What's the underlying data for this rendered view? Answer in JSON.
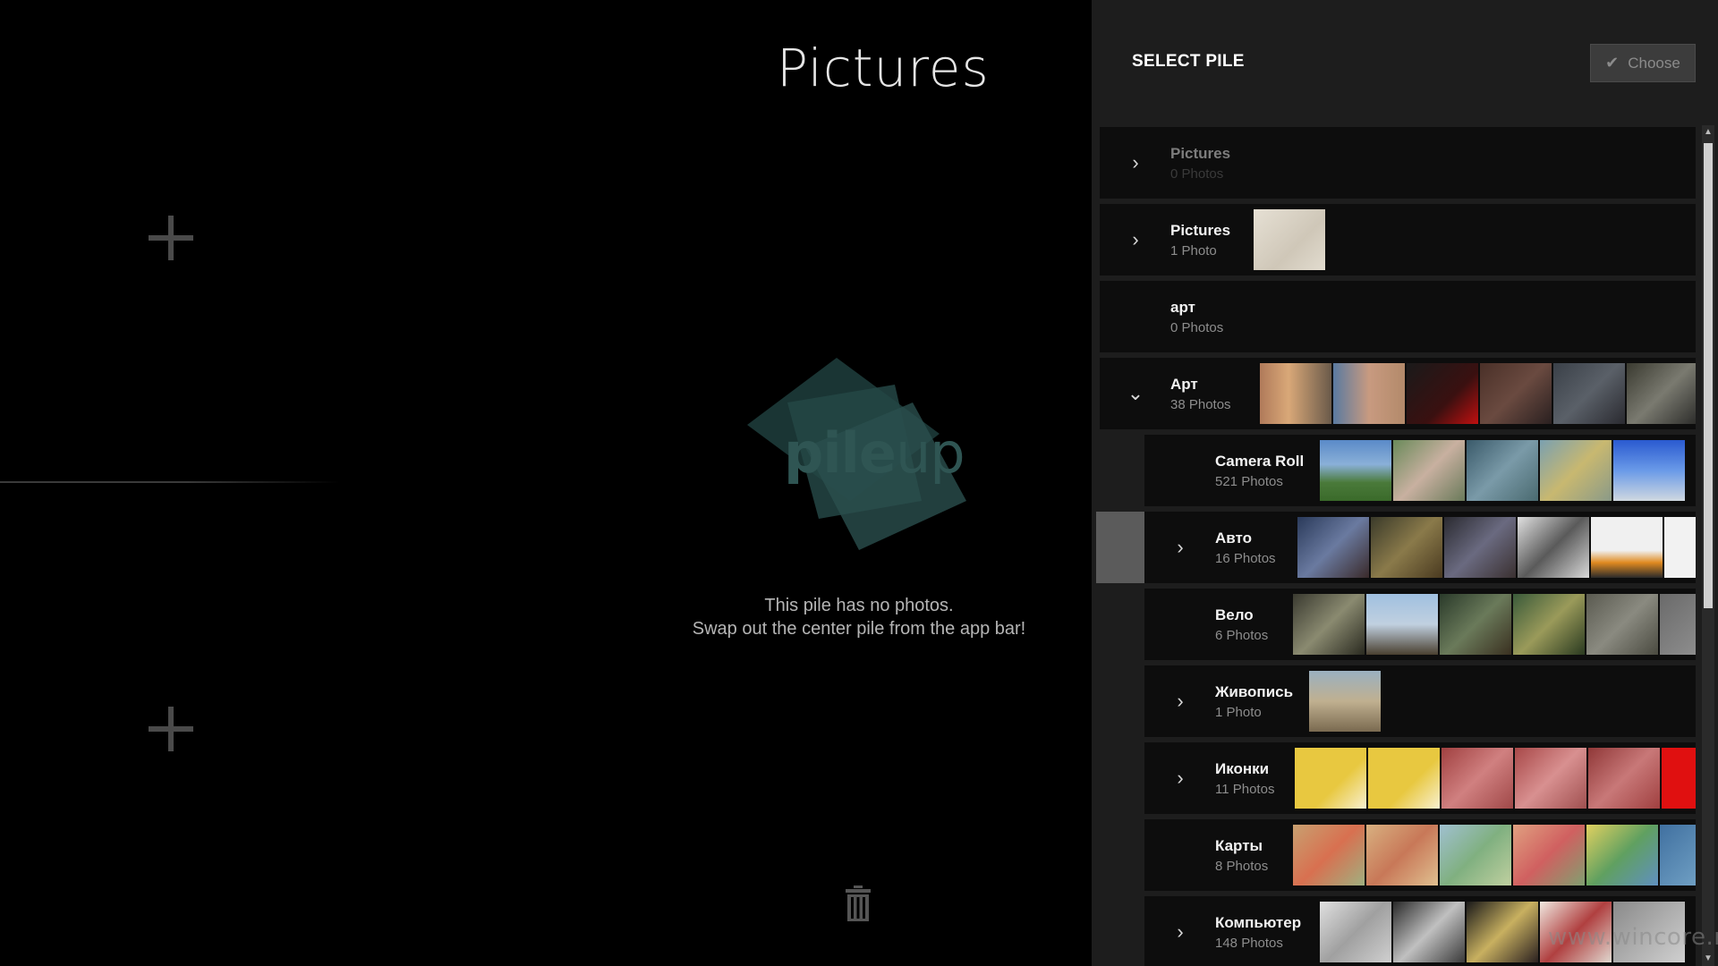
{
  "main": {
    "title": "Pictures",
    "logo_text_bold": "pile",
    "logo_text_light": "up",
    "empty_line1": "This pile has no photos.",
    "empty_line2": "Swap out the center pile from the app bar!"
  },
  "panel": {
    "title": "SELECT PILE",
    "choose_label": "Choose"
  },
  "piles": [
    {
      "name": "Pictures",
      "count": "0 Photos",
      "level": "top",
      "chevron": "right",
      "dim": true
    },
    {
      "name": "Pictures",
      "count": "1 Photo",
      "level": "top",
      "chevron": "right"
    },
    {
      "name": "арт",
      "count": "0 Photos",
      "level": "top",
      "chevron": "none"
    },
    {
      "name": "Арт",
      "count": "38 Photos",
      "level": "top",
      "chevron": "down"
    },
    {
      "name": "Camera Roll",
      "count": "521 Photos",
      "level": "sub",
      "chevron": "none"
    },
    {
      "name": "Авто",
      "count": "16 Photos",
      "level": "sub",
      "chevron": "right",
      "selected": true
    },
    {
      "name": "Вело",
      "count": "6 Photos",
      "level": "sub",
      "chevron": "none"
    },
    {
      "name": "Живопись",
      "count": "1 Photo",
      "level": "sub",
      "chevron": "right"
    },
    {
      "name": "Иконки",
      "count": "11 Photos",
      "level": "sub",
      "chevron": "right"
    },
    {
      "name": "Карты",
      "count": "8 Photos",
      "level": "sub",
      "chevron": "none"
    },
    {
      "name": "Компьютер",
      "count": "148 Photos",
      "level": "sub",
      "chevron": "right"
    }
  ],
  "watermark": "www.wincore.ru",
  "colors": {
    "accent_logo": "#2a4b4a",
    "panel_bg": "#1d1d1d",
    "row_bg": "#0d0d0d"
  }
}
